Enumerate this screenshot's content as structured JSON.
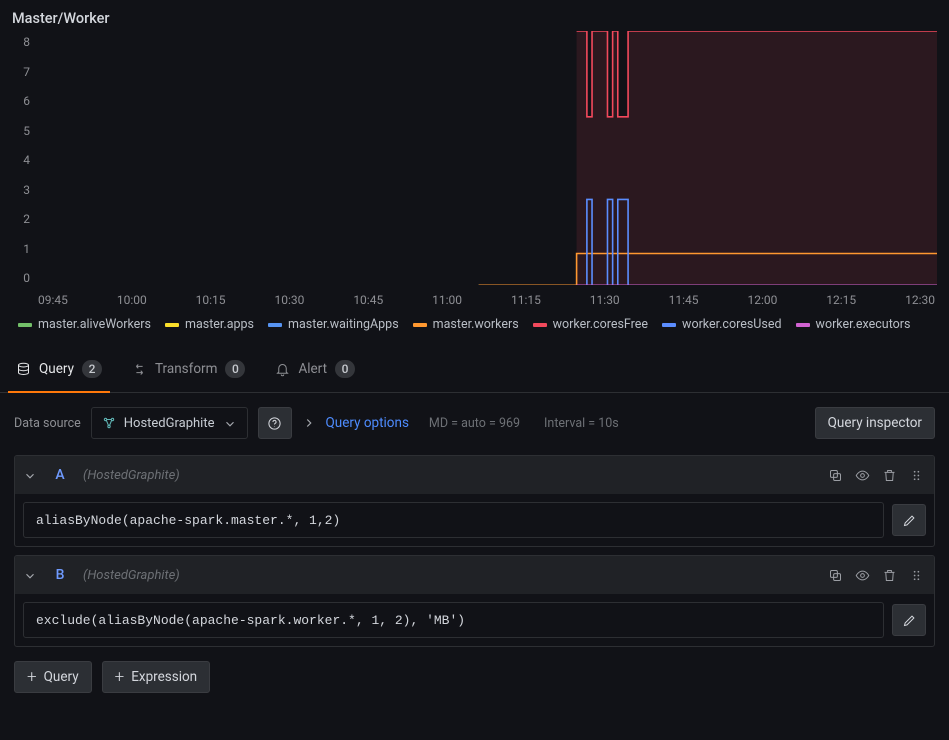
{
  "panel": {
    "title": "Master/Worker"
  },
  "chart_data": {
    "type": "line",
    "title": "Master/Worker",
    "xlabel": "",
    "ylabel": "",
    "ylim": [
      0,
      8
    ],
    "y_ticks": [
      8,
      7,
      6,
      5,
      4,
      3,
      2,
      1,
      0
    ],
    "x_ticks": [
      "09:45",
      "10:00",
      "10:15",
      "10:30",
      "10:45",
      "11:00",
      "11:15",
      "11:30",
      "11:45",
      "12:00",
      "12:15",
      "12:30"
    ],
    "xrange": [
      "09:40",
      "12:35"
    ],
    "series": [
      {
        "name": "master.aliveWorkers",
        "color": "#73bf69",
        "x": [
          "11:06",
          "11:25",
          "12:35"
        ],
        "y": [
          0,
          0,
          0
        ]
      },
      {
        "name": "master.apps",
        "color": "#fade2a",
        "x": [
          "11:06",
          "11:25",
          "12:35"
        ],
        "y": [
          0,
          0,
          0
        ]
      },
      {
        "name": "master.waitingApps",
        "color": "#5794f2",
        "x": [
          "11:06",
          "11:25",
          "12:35"
        ],
        "y": [
          0,
          0,
          0
        ]
      },
      {
        "name": "master.workers",
        "color": "#ff9830",
        "x": [
          "11:06",
          "11:25",
          "11:25",
          "12:35"
        ],
        "y": [
          0,
          0,
          1,
          1
        ]
      },
      {
        "name": "worker.coresFree",
        "color": "#f2495c",
        "x": [
          "11:25",
          "11:27",
          "11:27",
          "11:28",
          "11:28",
          "11:31",
          "11:31",
          "11:32",
          "11:32",
          "11:33",
          "11:33",
          "11:35",
          "11:35",
          "11:36",
          "11:36",
          "12:35"
        ],
        "y": [
          8,
          8,
          5.3,
          5.3,
          8,
          8,
          5.3,
          5.3,
          8,
          8,
          5.3,
          5.3,
          8,
          8,
          8,
          8
        ]
      },
      {
        "name": "worker.coresUsed",
        "color": "#5b8dff",
        "x": [
          "11:25",
          "11:27",
          "11:27",
          "11:28",
          "11:28",
          "11:31",
          "11:31",
          "11:32",
          "11:32",
          "11:33",
          "11:33",
          "11:35",
          "11:35",
          "11:36",
          "11:36",
          "12:35"
        ],
        "y": [
          0,
          0,
          2.7,
          2.7,
          0,
          0,
          2.7,
          2.7,
          0,
          0,
          2.7,
          2.7,
          0,
          0,
          0,
          0
        ]
      },
      {
        "name": "worker.executors",
        "color": "#d162d1",
        "x": [
          "11:25",
          "12:35"
        ],
        "y": [
          0,
          0
        ]
      }
    ]
  },
  "legend": [
    {
      "label": "master.aliveWorkers",
      "color": "#73bf69"
    },
    {
      "label": "master.apps",
      "color": "#fade2a"
    },
    {
      "label": "master.waitingApps",
      "color": "#5794f2"
    },
    {
      "label": "master.workers",
      "color": "#ff9830"
    },
    {
      "label": "worker.coresFree",
      "color": "#f2495c"
    },
    {
      "label": "worker.coresUsed",
      "color": "#5b8dff"
    },
    {
      "label": "worker.executors",
      "color": "#d162d1"
    }
  ],
  "tabs": {
    "query": {
      "label": "Query",
      "count": "2"
    },
    "transform": {
      "label": "Transform",
      "count": "0"
    },
    "alert": {
      "label": "Alert",
      "count": "0"
    }
  },
  "datasource": {
    "label": "Data source",
    "selected": "HostedGraphite",
    "query_options": "Query options",
    "md": "MD = auto = 969",
    "interval": "Interval = 10s",
    "inspector": "Query inspector"
  },
  "queries": [
    {
      "id": "A",
      "src": "(HostedGraphite)",
      "text": "aliasByNode(apache-spark.master.*, 1,2)"
    },
    {
      "id": "B",
      "src": "(HostedGraphite)",
      "text": "exclude(aliasByNode(apache-spark.worker.*, 1, 2), 'MB')"
    }
  ],
  "buttons": {
    "add_query": "Query",
    "add_expression": "Expression"
  }
}
